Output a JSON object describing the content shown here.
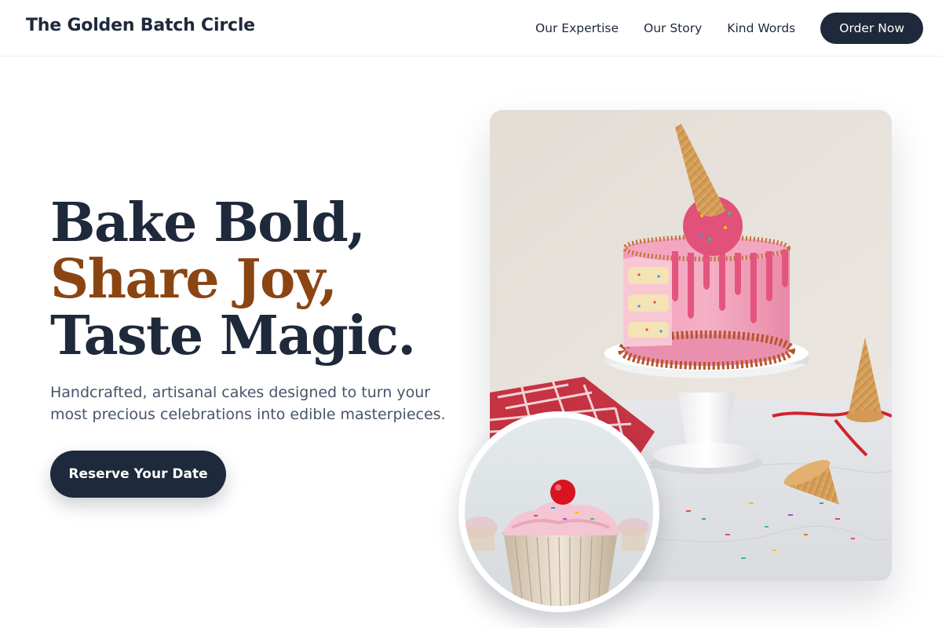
{
  "header": {
    "brand": "The Golden Batch Circle",
    "nav": [
      {
        "label": "Our Expertise"
      },
      {
        "label": "Our Story"
      },
      {
        "label": "Kind Words"
      }
    ],
    "cta_label": "Order Now"
  },
  "hero": {
    "title_lines": [
      "Bake Bold,",
      "Share Joy,",
      "Taste Magic."
    ],
    "subtitle": "Handcrafted, artisanal cakes designed to turn your most precious celebrations into edible masterpieces.",
    "button_label": "Reserve Your Date"
  },
  "images": {
    "main": {
      "subject": "pink-drip-cake-with-ice-cream-cone"
    },
    "inset": {
      "subject": "pink-frosted-cupcake"
    }
  },
  "colors": {
    "navy": "#1e293b",
    "accent": "#8b4513",
    "body_text": "#475569"
  }
}
